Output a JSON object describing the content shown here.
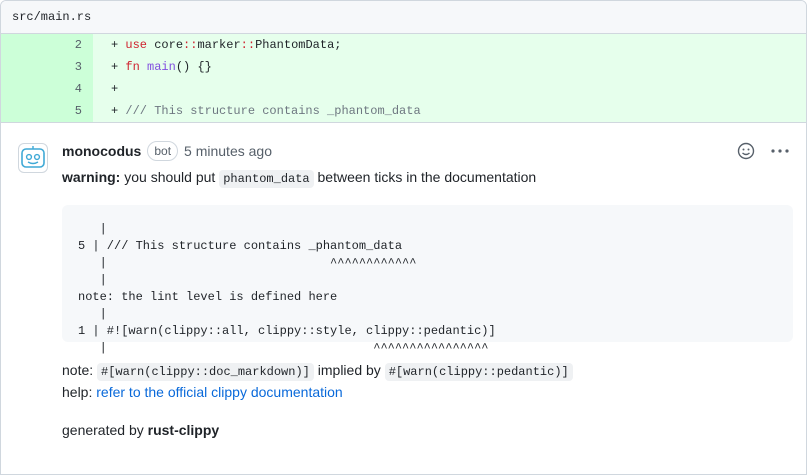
{
  "file": {
    "path": "src/main.rs"
  },
  "diff": {
    "lines": [
      {
        "num": "2",
        "prefix": "+ ",
        "kw": "use",
        "rest": " core::marker::PhantomData;"
      },
      {
        "num": "3",
        "prefix": "+ ",
        "kw": "fn",
        "fn": " main",
        "rest": "() {}"
      },
      {
        "num": "4",
        "prefix": "+",
        "rest": ""
      },
      {
        "num": "5",
        "prefix": "+ ",
        "comment": "/// This structure contains _phantom_data"
      }
    ]
  },
  "comment": {
    "author": "monocodus",
    "badge": "bot",
    "timestamp": "5 minutes ago",
    "warning_label": "warning:",
    "warning_text_1": " you should put ",
    "warning_code": "phantom_data",
    "warning_text_2": " between ticks in the documentation",
    "code_block": [
      "   |",
      "5 | /// This structure contains _phantom_data",
      "   |                               ^^^^^^^^^^^^",
      "   |",
      "note: the lint level is defined here",
      "   |",
      "1 | #![warn(clippy::all, clippy::style, clippy::pedantic)]",
      "   |                                     ^^^^^^^^^^^^^^^^"
    ],
    "note_label": "note: ",
    "note_code_1": "#[warn(clippy::doc_markdown)]",
    "note_implied": " implied by ",
    "note_code_2": "#[warn(clippy::pedantic)]",
    "help_label": "help: ",
    "help_link": "refer to the official clippy documentation",
    "generated_by": "generated by ",
    "generator": "rust-clippy"
  },
  "icons": {
    "reaction": "smiley-icon",
    "more": "kebab-icon",
    "avatar": "bot-avatar-icon"
  }
}
